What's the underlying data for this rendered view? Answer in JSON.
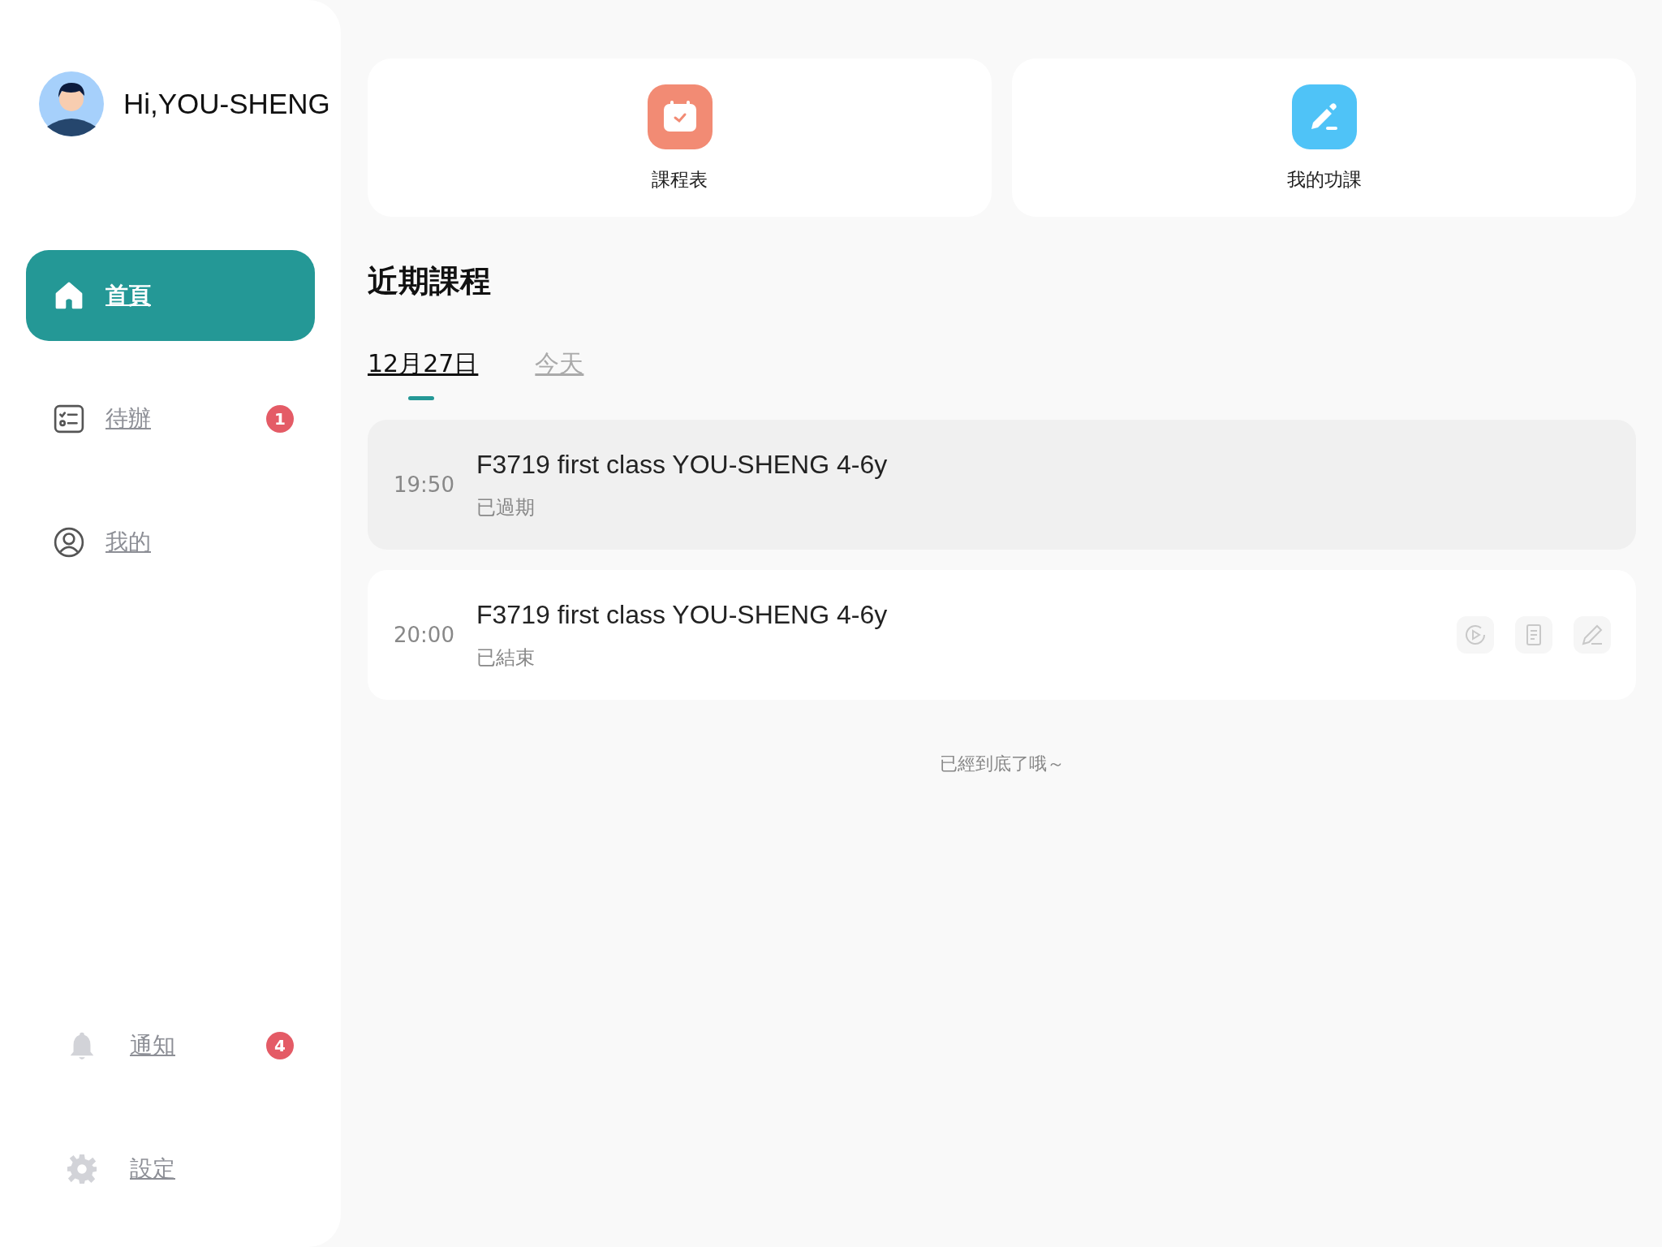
{
  "user": {
    "greeting": "Hi,YOU-SHENG"
  },
  "nav": [
    {
      "label": "首頁",
      "selected": true
    },
    {
      "label": "待辦",
      "selected": false,
      "badge": "1"
    },
    {
      "label": "我的",
      "selected": false
    }
  ],
  "nav_bottom": [
    {
      "label": "通知",
      "badge": "4"
    },
    {
      "label": "設定"
    }
  ],
  "shortcuts": [
    {
      "label": "課程表",
      "color": "#f28b74"
    },
    {
      "label": "我的功課",
      "color": "#4fc3f7"
    }
  ],
  "section_title": "近期課程",
  "tabs": [
    {
      "label": "12月27日",
      "selected": true
    },
    {
      "label": "今天",
      "selected": false
    }
  ],
  "courses": [
    {
      "kind": "expired",
      "time": "19:50",
      "title": "F3719 first class YOU-SHENG 4-6y",
      "status": "已過期"
    },
    {
      "kind": "ended",
      "time": "20:00",
      "title": "F3719 first class YOU-SHENG 4-6y",
      "status": "已結束"
    }
  ],
  "footer": "已經到底了哦～"
}
